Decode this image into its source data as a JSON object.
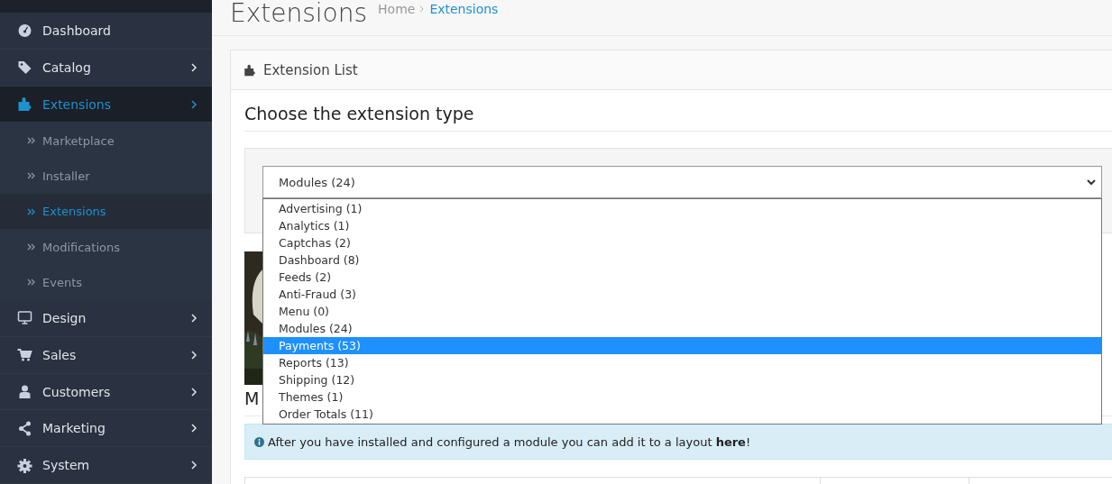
{
  "sidebar": {
    "items": [
      {
        "label": "Dashboard",
        "selected": false
      },
      {
        "label": "Catalog",
        "selected": false
      },
      {
        "label": "Extensions",
        "selected": true,
        "children": [
          {
            "label": "Marketplace",
            "selected": false
          },
          {
            "label": "Installer",
            "selected": false
          },
          {
            "label": "Extensions",
            "selected": true
          },
          {
            "label": "Modifications",
            "selected": false
          },
          {
            "label": "Events",
            "selected": false
          }
        ]
      },
      {
        "label": "Design",
        "selected": false
      },
      {
        "label": "Sales",
        "selected": false
      },
      {
        "label": "Customers",
        "selected": false
      },
      {
        "label": "Marketing",
        "selected": false
      },
      {
        "label": "System",
        "selected": false
      }
    ]
  },
  "page": {
    "title": "Extensions",
    "breadcrumb": [
      {
        "label": "Home",
        "selected": false
      },
      {
        "label": "Extensions",
        "selected": true
      }
    ]
  },
  "panel": {
    "title": "Extension List",
    "heading": "Choose the extension type",
    "select": {
      "value": "Modules (24)",
      "options": [
        {
          "label": "Advertising (1)",
          "highlighted": false
        },
        {
          "label": "Analytics (1)",
          "highlighted": false
        },
        {
          "label": "Captchas (2)",
          "highlighted": false
        },
        {
          "label": "Dashboard (8)",
          "highlighted": false
        },
        {
          "label": "Feeds (2)",
          "highlighted": false
        },
        {
          "label": "Anti-Fraud (3)",
          "highlighted": false
        },
        {
          "label": "Menu (0)",
          "highlighted": false
        },
        {
          "label": "Modules (24)",
          "highlighted": false
        },
        {
          "label": "Payments (53)",
          "highlighted": true
        },
        {
          "label": "Reports (13)",
          "highlighted": false
        },
        {
          "label": "Shipping (12)",
          "highlighted": false
        },
        {
          "label": "Themes (1)",
          "highlighted": false
        },
        {
          "label": "Order Totals (11)",
          "highlighted": false
        }
      ]
    },
    "section_heading": "M",
    "alert": {
      "text": "After you have installed and configured a module you can add it to a layout ",
      "link": "here",
      "after": "!"
    }
  }
}
